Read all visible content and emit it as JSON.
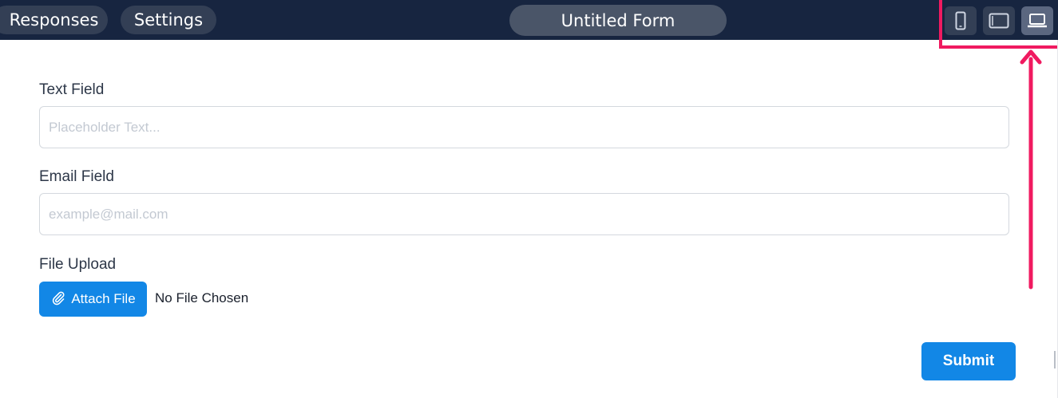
{
  "topbar": {
    "responses_label": "Responses",
    "settings_label": "Settings",
    "form_title": "Untitled Form",
    "background_color": "#172540",
    "devices": [
      {
        "name": "mobile",
        "icon": "mobile-icon",
        "active": false
      },
      {
        "name": "tablet",
        "icon": "tablet-icon",
        "active": false
      },
      {
        "name": "desktop",
        "icon": "laptop-icon",
        "active": true
      }
    ]
  },
  "form": {
    "text_field": {
      "label": "Text Field",
      "value": "",
      "placeholder": "Placeholder Text..."
    },
    "email_field": {
      "label": "Email Field",
      "value": "",
      "placeholder": "example@mail.com"
    },
    "file_upload": {
      "label": "File Upload",
      "button_label": "Attach File",
      "button_icon": "paperclip-icon",
      "status": "No File Chosen"
    },
    "submit_label": "Submit"
  },
  "annotation": {
    "color": "#f01a60"
  },
  "accent_color": "#1287e6"
}
